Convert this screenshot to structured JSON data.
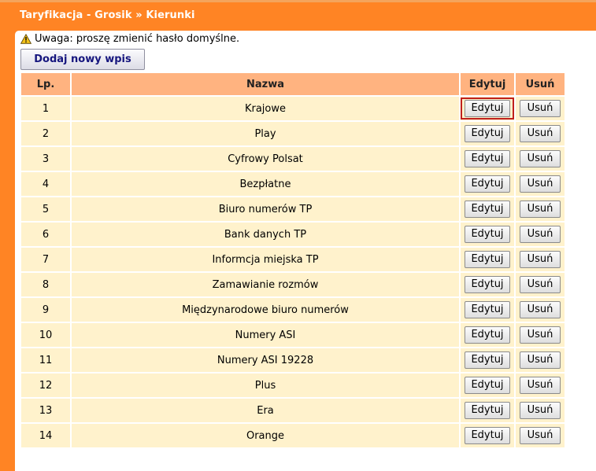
{
  "header": {
    "title": "Taryfikacja - Grosik » Kierunki"
  },
  "warning": {
    "icon": "warning-icon",
    "text": "Uwaga: proszę zmienić hasło domyślne."
  },
  "toolbar": {
    "add_label": "Dodaj nowy wpis"
  },
  "table": {
    "columns": {
      "lp": "Lp.",
      "name": "Nazwa",
      "edit": "Edytuj",
      "delete": "Usuń"
    },
    "rows": [
      {
        "lp": "1",
        "name": "Krajowe",
        "edit": "Edytuj",
        "delete": "Usuń"
      },
      {
        "lp": "2",
        "name": "Play",
        "edit": "Edytuj",
        "delete": "Usuń"
      },
      {
        "lp": "3",
        "name": "Cyfrowy Polsat",
        "edit": "Edytuj",
        "delete": "Usuń"
      },
      {
        "lp": "4",
        "name": "Bezpłatne",
        "edit": "Edytuj",
        "delete": "Usuń"
      },
      {
        "lp": "5",
        "name": "Biuro numerów TP",
        "edit": "Edytuj",
        "delete": "Usuń"
      },
      {
        "lp": "6",
        "name": "Bank danych TP",
        "edit": "Edytuj",
        "delete": "Usuń"
      },
      {
        "lp": "7",
        "name": "Informcja miejska TP",
        "edit": "Edytuj",
        "delete": "Usuń"
      },
      {
        "lp": "8",
        "name": "Zamawianie rozmów",
        "edit": "Edytuj",
        "delete": "Usuń"
      },
      {
        "lp": "9",
        "name": "Międzynarodowe biuro numerów",
        "edit": "Edytuj",
        "delete": "Usuń"
      },
      {
        "lp": "10",
        "name": "Numery ASI",
        "edit": "Edytuj",
        "delete": "Usuń"
      },
      {
        "lp": "11",
        "name": "Numery ASI 19228",
        "edit": "Edytuj",
        "delete": "Usuń"
      },
      {
        "lp": "12",
        "name": "Plus",
        "edit": "Edytuj",
        "delete": "Usuń"
      },
      {
        "lp": "13",
        "name": "Era",
        "edit": "Edytuj",
        "delete": "Usuń"
      },
      {
        "lp": "14",
        "name": "Orange",
        "edit": "Edytuj",
        "delete": "Usuń"
      }
    ]
  },
  "colors": {
    "accent": "#ff8424",
    "header_cell": "#ffb380",
    "row_cell": "#fff2cc",
    "highlight": "#c0201c",
    "button_text": "#16167e"
  }
}
